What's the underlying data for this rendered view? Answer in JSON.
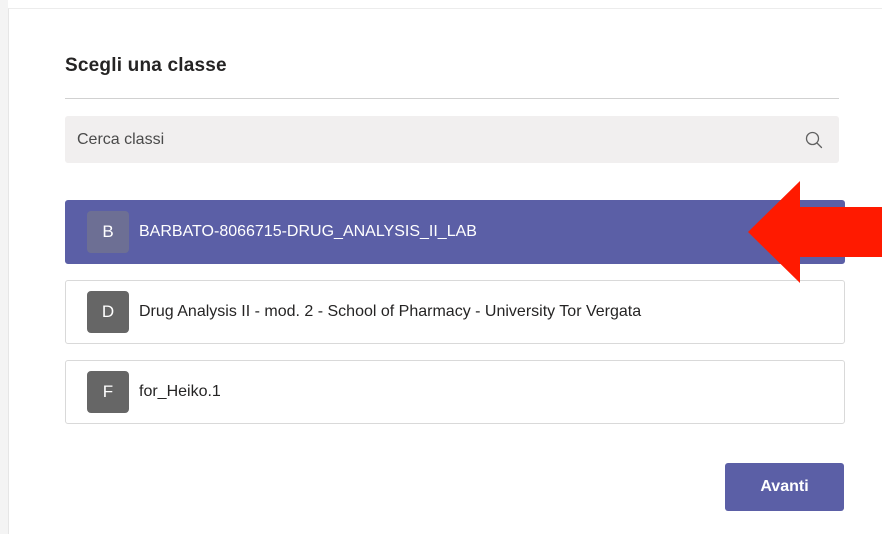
{
  "dialog": {
    "title": "Scegli una classe"
  },
  "search": {
    "placeholder": "Cerca classi",
    "icon": "search-icon"
  },
  "classes": [
    {
      "initial": "B",
      "name": "BARBATO-8066715-DRUG_ANALYSIS_II_LAB",
      "selected": true
    },
    {
      "initial": "D",
      "name": "Drug Analysis II - mod. 2 - School of Pharmacy - University Tor Vergata",
      "selected": false
    },
    {
      "initial": "F",
      "name": "for_Heiko.1",
      "selected": false
    }
  ],
  "footer": {
    "next_label": "Avanti"
  },
  "colors": {
    "accent": "#5b5fa6",
    "avatar": "#666666",
    "annotation_arrow": "#ff1a00"
  }
}
